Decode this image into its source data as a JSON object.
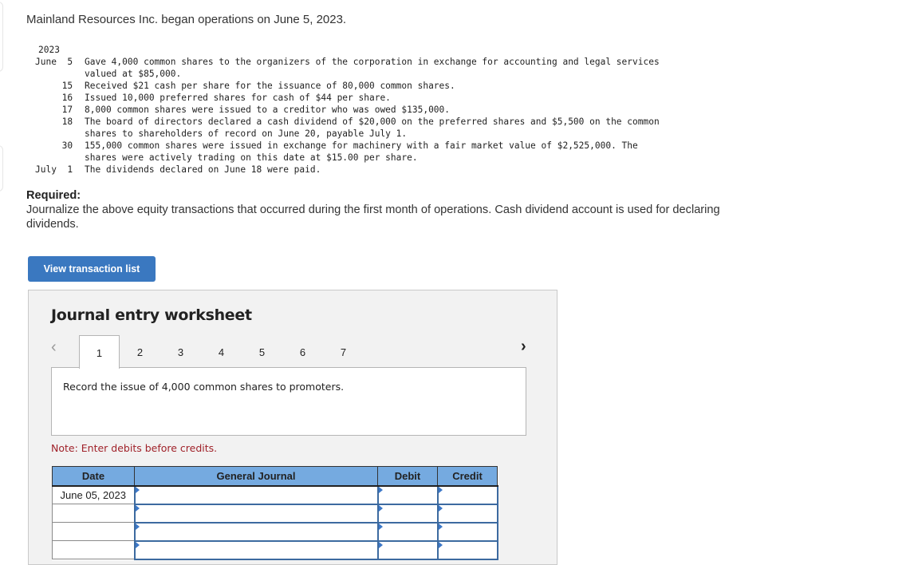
{
  "intro": "Mainland Resources Inc. began operations on June 5, 2023.",
  "facts": {
    "year": "2023",
    "rows": [
      {
        "date": "June  5",
        "text": "Gave 4,000 common shares to the organizers of the corporation in exchange for accounting and legal services"
      },
      {
        "date": "",
        "text": "valued at $85,000."
      },
      {
        "date": "     15",
        "text": "Received $21 cash per share for the issuance of 80,000 common shares."
      },
      {
        "date": "     16",
        "text": "Issued 10,000 preferred shares for cash of $44 per share."
      },
      {
        "date": "     17",
        "text": "8,000 common shares were issued to a creditor who was owed $135,000."
      },
      {
        "date": "     18",
        "text": "The board of directors declared a cash dividend of $20,000 on the preferred shares and $5,500 on the common"
      },
      {
        "date": "",
        "text": "shares to shareholders of record on June 20, payable July 1."
      },
      {
        "date": "     30",
        "text": "155,000 common shares were issued in exchange for machinery with a fair market value of $2,525,000. The"
      },
      {
        "date": "",
        "text": "shares were actively trading on this date at $15.00 per share."
      },
      {
        "date": "July  1",
        "text": "The dividends declared on June 18 were paid."
      }
    ]
  },
  "required": {
    "label": "Required:",
    "text": "Journalize the above equity transactions that occurred during the first month of operations. Cash dividend account is used for declaring dividends."
  },
  "buttons": {
    "view_transaction_list": "View transaction list"
  },
  "worksheet": {
    "title": "Journal entry worksheet",
    "prev_icon": "‹",
    "next_icon": "›",
    "tabs": [
      "1",
      "2",
      "3",
      "4",
      "5",
      "6",
      "7"
    ],
    "active_tab": "1",
    "instruction": "Record the issue of 4,000 common shares to promoters.",
    "note": "Note: Enter debits before credits.",
    "table": {
      "headers": {
        "date": "Date",
        "general_journal": "General Journal",
        "debit": "Debit",
        "credit": "Credit"
      },
      "rows": [
        {
          "date": "June 05, 2023",
          "account": "",
          "debit": "",
          "credit": ""
        },
        {
          "date": "",
          "account": "",
          "debit": "",
          "credit": ""
        },
        {
          "date": "",
          "account": "",
          "debit": "",
          "credit": ""
        },
        {
          "date": "",
          "account": "",
          "debit": "",
          "credit": ""
        }
      ]
    }
  },
  "colors": {
    "button_blue": "#3a78c0",
    "header_blue": "#75aae0",
    "note_red": "#a0222a"
  }
}
